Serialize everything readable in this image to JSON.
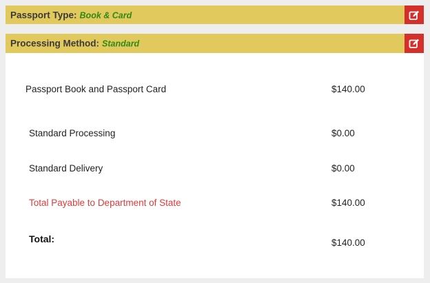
{
  "passport_bar": {
    "label": "Passport Type:",
    "value": "Book & Card",
    "edit_icon": "edit-icon"
  },
  "method_bar": {
    "label": "Processing Method:",
    "value": "Standard",
    "edit_icon": "edit-icon"
  },
  "colors": {
    "bar_background": "#e2c95e",
    "value_green": "#2f8a12",
    "edit_red": "#d42f2b",
    "total_payable_red": "#e03a3a"
  },
  "fees": {
    "items": [
      {
        "label": "Passport Book and Passport Card",
        "amount": "$140.00"
      },
      {
        "label": "Standard Processing",
        "amount": "$0.00"
      },
      {
        "label": "Standard Delivery",
        "amount": "$0.00"
      },
      {
        "label": "Total Payable to Department of State",
        "amount": "$140.00"
      }
    ],
    "total": {
      "label": "Total:",
      "amount": "$140.00"
    }
  }
}
